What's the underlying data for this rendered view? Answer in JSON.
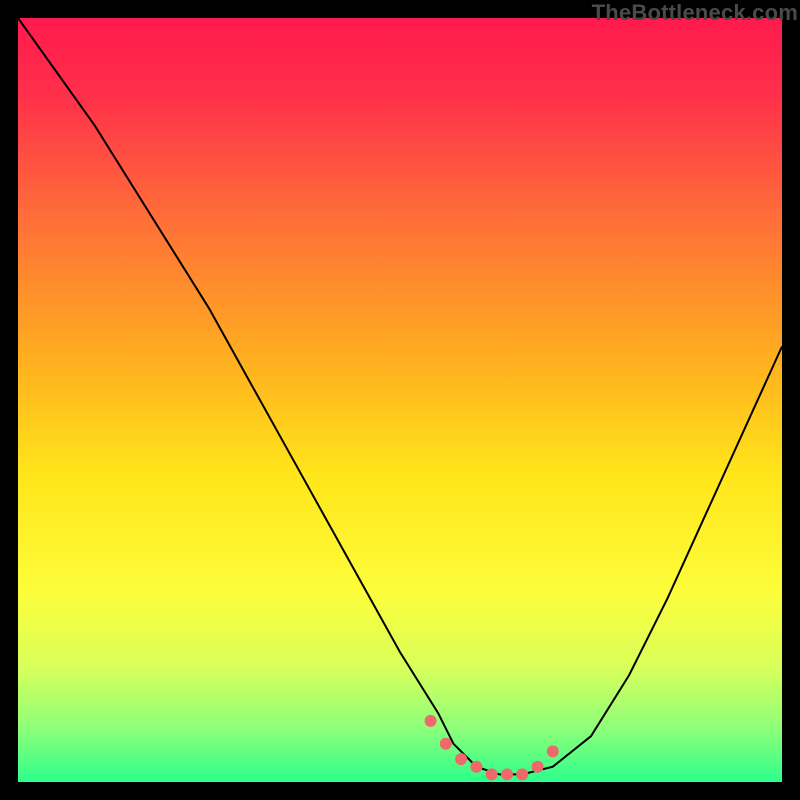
{
  "watermark": "TheBottleneck.com",
  "chart_data": {
    "type": "line",
    "title": "",
    "xlabel": "",
    "ylabel": "",
    "xlim": [
      0,
      100
    ],
    "ylim": [
      0,
      100
    ],
    "background_gradient": {
      "stops": [
        {
          "pos": 0.0,
          "color": "#ff1a4d"
        },
        {
          "pos": 0.1,
          "color": "#ff2f4a"
        },
        {
          "pos": 0.25,
          "color": "#ff6a3a"
        },
        {
          "pos": 0.45,
          "color": "#ffb01f"
        },
        {
          "pos": 0.6,
          "color": "#ffe61a"
        },
        {
          "pos": 0.75,
          "color": "#fdfd3a"
        },
        {
          "pos": 0.85,
          "color": "#d8ff5a"
        },
        {
          "pos": 0.93,
          "color": "#8dff7a"
        },
        {
          "pos": 1.0,
          "color": "#2cff8a"
        }
      ]
    },
    "series": [
      {
        "name": "curve",
        "color": "#000000",
        "x": [
          0,
          5,
          10,
          15,
          20,
          25,
          30,
          35,
          40,
          45,
          50,
          55,
          57,
          60,
          63,
          66,
          70,
          75,
          80,
          85,
          90,
          95,
          100
        ],
        "y": [
          100,
          93,
          86,
          78,
          70,
          62,
          53,
          44,
          35,
          26,
          17,
          9,
          5,
          2,
          1,
          1,
          2,
          6,
          14,
          24,
          35,
          46,
          57
        ]
      }
    ],
    "markers": {
      "name": "highlight-dots",
      "color": "#ee6a6a",
      "radius": 6,
      "x": [
        54,
        56,
        58,
        60,
        62,
        64,
        66,
        68,
        70
      ],
      "y": [
        8,
        5,
        3,
        2,
        1,
        1,
        1,
        2,
        4
      ]
    }
  }
}
